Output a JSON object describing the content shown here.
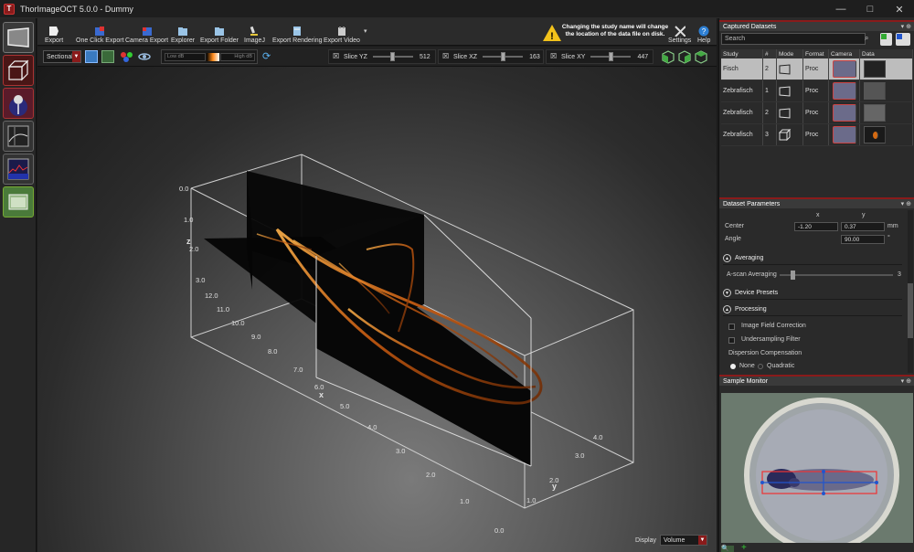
{
  "window": {
    "title": "ThorImageOCT 5.0.0 - Dummy"
  },
  "toolbar": {
    "items": [
      "Export",
      "One Click Export",
      "Camera Export",
      "Explorer",
      "Export Folder",
      "ImageJ",
      "Export Rendering",
      "Export Video"
    ],
    "warning": "Changing the study name will change the location of the data file on disk.",
    "settings": "Settings",
    "help": "Help"
  },
  "subbar": {
    "view_mode": "Sectional",
    "low_db": "Low dB",
    "high_db": "High dB",
    "slices": [
      {
        "label": "Slice YZ",
        "value": "512",
        "position": 0.5
      },
      {
        "label": "Slice XZ",
        "value": "163",
        "position": 0.5
      },
      {
        "label": "Slice XY",
        "value": "447",
        "position": 0.5
      }
    ]
  },
  "viewport": {
    "z_label": "z",
    "x_label": "x",
    "y_label": "y",
    "z_ticks": [
      "0.0",
      "1.0",
      "2.0",
      "3.0"
    ],
    "x_ticks": [
      "12.0",
      "11.0",
      "10.0",
      "9.0",
      "8.0",
      "7.0",
      "6.0",
      "5.0",
      "4.0",
      "3.0",
      "2.0",
      "1.0",
      "0.0"
    ],
    "y_ticks": [
      "4.0",
      "3.0",
      "2.0",
      "1.0"
    ],
    "display_label": "Display",
    "display_value": "Volume"
  },
  "captured": {
    "header": "Captured Datasets",
    "search_placeholder": "Search",
    "columns": [
      "Study",
      "#",
      "Mode",
      "Format",
      "Camera",
      "Data"
    ],
    "rows": [
      {
        "study": "Fisch",
        "num": "2",
        "format": "Proc",
        "selected": true
      },
      {
        "study": "Zebrafisch",
        "num": "1",
        "format": "Proc",
        "selected": false
      },
      {
        "study": "Zebrafisch",
        "num": "2",
        "format": "Proc",
        "selected": false
      },
      {
        "study": "Zebrafisch",
        "num": "3",
        "format": "Proc",
        "selected": false
      }
    ]
  },
  "params": {
    "header": "Dataset Parameters",
    "x_col": "x",
    "y_col": "y",
    "center_label": "Center",
    "center_x": "-1.20",
    "center_y": "0.37",
    "center_unit": "mm",
    "angle_label": "Angle",
    "angle_value": "90.00",
    "angle_unit": "°",
    "averaging": "Averaging",
    "ascan_label": "A-scan Averaging",
    "ascan_value": "3",
    "ascan_level": 0.1,
    "device_presets": "Device Presets",
    "processing": "Processing",
    "image_field": "Image Field Correction",
    "undersampling": "Undersampling Filter",
    "dispersion": "Dispersion Compensation",
    "disp_none": "None",
    "disp_quadratic": "Quadratic"
  },
  "monitor": {
    "header": "Sample Monitor"
  },
  "colors": {
    "accent": "#8a1b1b",
    "selection": "#bdbdbd",
    "orange": "#ff8a1a"
  }
}
